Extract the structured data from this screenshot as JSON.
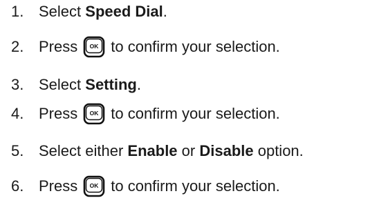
{
  "steps": [
    {
      "number": "1.",
      "pre": "Select ",
      "bold": "Speed Dial",
      "post": "."
    },
    {
      "number": "2.",
      "pre": "Press",
      "icon": "ok-key-icon",
      "icon_label": "OK",
      "post": "to confirm your selection."
    },
    {
      "number": "3.",
      "pre": "Select ",
      "bold": "Setting",
      "post": "."
    },
    {
      "number": "4.",
      "pre": "Press",
      "icon": "ok-key-icon",
      "icon_label": "OK",
      "post": "to confirm your selection."
    },
    {
      "number": "5.",
      "pre": "Select either ",
      "bold": "Enable",
      "mid": " or ",
      "bold2": "Disable",
      "post": " option."
    },
    {
      "number": "6.",
      "pre": "Press",
      "icon": "ok-key-icon",
      "icon_label": "OK",
      "post": "to confirm your selection."
    }
  ]
}
